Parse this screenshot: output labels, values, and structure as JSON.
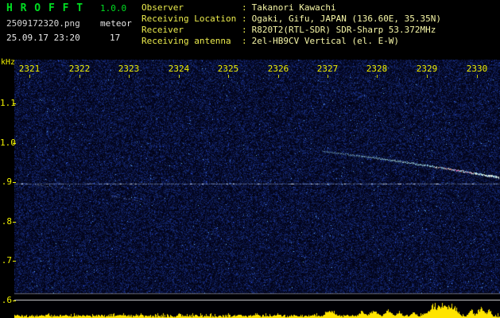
{
  "header": {
    "app_title": "H R O F F T",
    "version": "1.0.0",
    "filename": "2509172320.png",
    "mode": "meteor",
    "datetime": "25.09.17 23:20",
    "count": "17",
    "colon": ":",
    "info": [
      {
        "label": "Observer",
        "value": "Takanori Kawachi"
      },
      {
        "label": "Receiving Location",
        "value": "Ogaki, Gifu, JAPAN (136.60E, 35.35N)"
      },
      {
        "label": "Receiver",
        "value": "R820T2(RTL-SDR) SDR-Sharp 53.372MHz"
      },
      {
        "label": "Receiving antenna",
        "value": "2el-HB9CV Vertical (el. E-W)"
      }
    ]
  },
  "spectrogram": {
    "y_unit": "kHz",
    "x_ticks": [
      "2321",
      "2322",
      "2323",
      "2324",
      "2325",
      "2326",
      "2327",
      "2328",
      "2329",
      "2330"
    ],
    "y_ticks": [
      "1.1",
      "1.0",
      ".9",
      ".8",
      ".7",
      ".6"
    ],
    "features": {
      "carrier_khz": 0.896,
      "trace": {
        "t_start": 2326.9,
        "t_end": 2330.5,
        "f_start_khz": 0.978,
        "f_end_khz": 0.912
      }
    }
  }
}
